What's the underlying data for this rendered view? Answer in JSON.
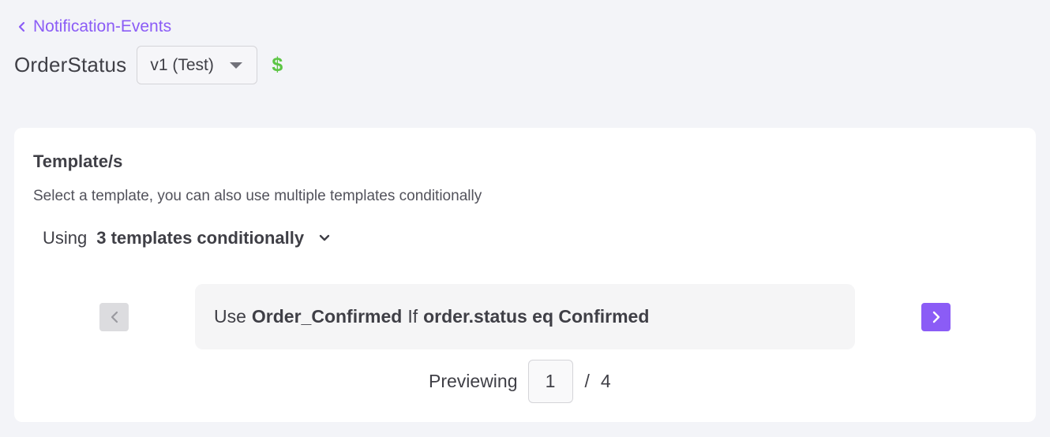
{
  "breadcrumb": {
    "back_label": "Notification-Events"
  },
  "header": {
    "title": "OrderStatus",
    "version_selected": "v1 (Test)",
    "billing_icon_glyph": "$",
    "billing_icon_color": "#5cc544"
  },
  "templates_card": {
    "title": "Template/s",
    "description": "Select a template, you can also use multiple templates conditionally",
    "using_prefix": "Using",
    "using_value": "3 templates conditionally",
    "rule": {
      "use_word": "Use",
      "template_name": "Order_Confirmed",
      "if_word": "If",
      "condition": "order.status eq Confirmed"
    },
    "preview": {
      "label": "Previewing",
      "current_page": "1",
      "separator": "/",
      "total_pages": "4"
    }
  },
  "colors": {
    "accent": "#8b5cf6",
    "background": "#f3f4f8",
    "card": "#ffffff",
    "disabled_button": "#dcdcdf"
  },
  "icons": {
    "back": "chevron-left-icon",
    "version_dropdown": "caret-down-icon",
    "billing": "dollar-icon",
    "using_dropdown": "chevron-down-icon",
    "prev": "chevron-left-icon",
    "next": "chevron-right-icon"
  }
}
